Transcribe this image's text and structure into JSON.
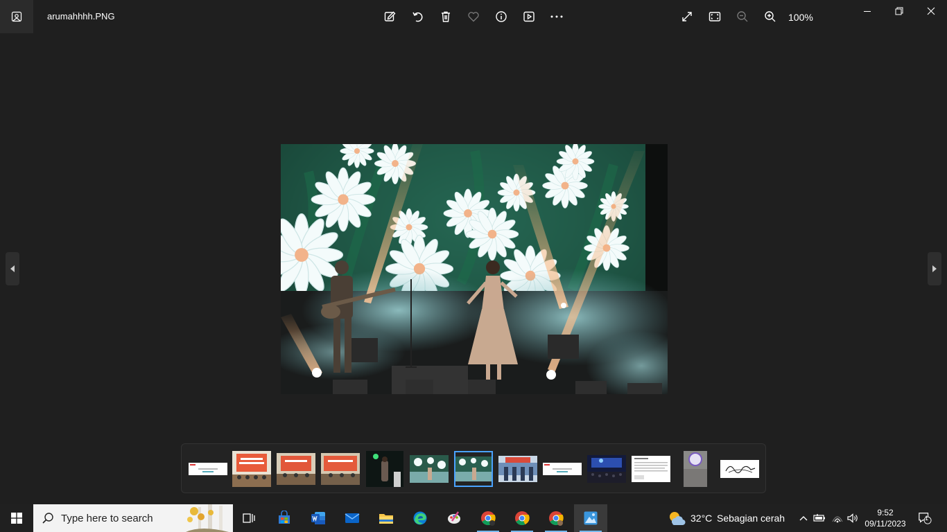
{
  "window": {
    "file_name": "arumahhhh.PNG",
    "zoom": "100%",
    "toolbar": [
      "edit-image-icon",
      "rotate-icon",
      "delete-icon",
      "favorite-icon",
      "info-icon",
      "slideshow-icon",
      "more-icon"
    ],
    "view_controls": [
      "expand-icon",
      "fit-to-window-icon",
      "zoom-out-icon",
      "zoom-in-icon"
    ]
  },
  "colors": {
    "accent": "#4aa3ff",
    "background": "#1f1f1f",
    "taskbar": "#202020"
  },
  "taskbar": {
    "search_placeholder": "Type here to search",
    "weather": {
      "temp": "32°C",
      "desc": "Sebagian cerah"
    },
    "time": "9:52",
    "date": "09/11/2023",
    "notification_count": "1"
  }
}
